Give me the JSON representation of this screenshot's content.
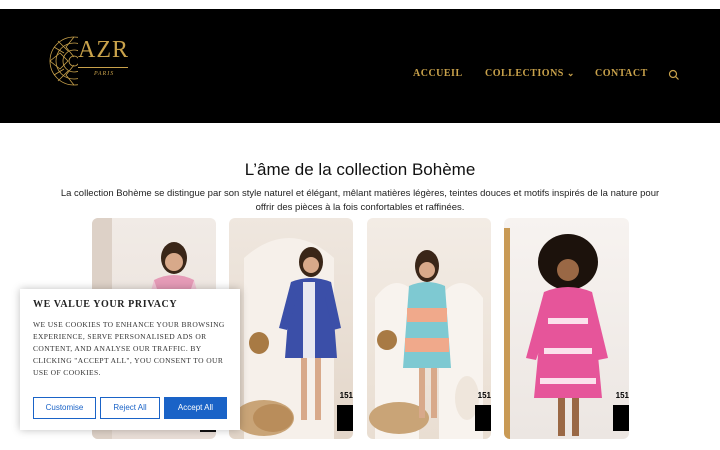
{
  "brand": {
    "name": "AZR",
    "subtitle": "PARIS"
  },
  "nav": {
    "home": "ACCUEIL",
    "collections": "COLLECTIONS",
    "contact": "CONTACT"
  },
  "section": {
    "title": "L’âme de la collection Bohème",
    "description": "La collection Bohème se distingue par son style naturel et élégant, mêlant matières légères, teintes douces et motifs inspirés de la nature pour offrir des pièces à la fois confortables et raffinées."
  },
  "products": [
    {
      "price": "",
      "dress_color": "#e59bb7"
    },
    {
      "price": "151",
      "dress_color": "#3b4fa8"
    },
    {
      "price": "151",
      "dress_color": "#7ec9d2"
    },
    {
      "price": "151",
      "dress_color": "#e6559a"
    }
  ],
  "cookie": {
    "title": "WE VALUE YOUR PRIVACY",
    "text": "WE USE COOKIES TO ENHANCE YOUR BROWSING EXPERIENCE, SERVE PERSONALISED ADS OR CONTENT, AND ANALYSE OUR TRAFFIC. BY CLICKING \"ACCEPT ALL\", YOU CONSENT TO OUR USE OF COOKIES.",
    "customise": "Customise",
    "reject": "Reject All",
    "accept": "Accept All"
  },
  "colors": {
    "gold": "#c9a24b",
    "header_bg": "#000000",
    "accent_blue": "#1a63c7"
  }
}
